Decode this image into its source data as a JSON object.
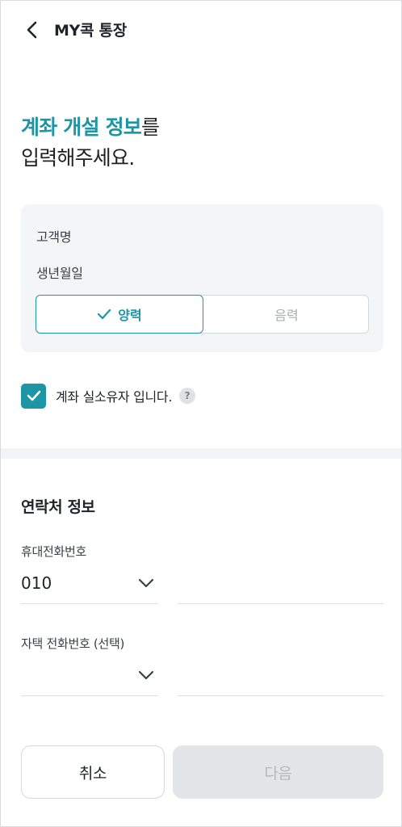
{
  "header": {
    "title": "MY콕 통장",
    "back_icon": "chevron-left-icon"
  },
  "headline": {
    "accent": "계좌 개설 정보",
    "accent_suffix": "를",
    "line2": "입력해주세요."
  },
  "customer_info": {
    "name_label": "고객명",
    "birth_label": "생년월일",
    "calendar_options": {
      "solar": "양력",
      "lunar": "음력",
      "selected": "solar"
    }
  },
  "owner_confirm": {
    "label": "계좌 실소유자 입니다.",
    "checked": true,
    "help_symbol": "?"
  },
  "contact": {
    "title": "연락처 정보",
    "mobile": {
      "label": "휴대전화번호",
      "prefix": "010",
      "number": ""
    },
    "home": {
      "label": "자택 전화번호 (선택)",
      "prefix": "",
      "number": ""
    }
  },
  "actions": {
    "cancel": "취소",
    "next": "다음"
  },
  "colors": {
    "accent": "#1d95a4",
    "disabled_bg": "#e3e5e8",
    "disabled_text": "#b4b8bd"
  }
}
